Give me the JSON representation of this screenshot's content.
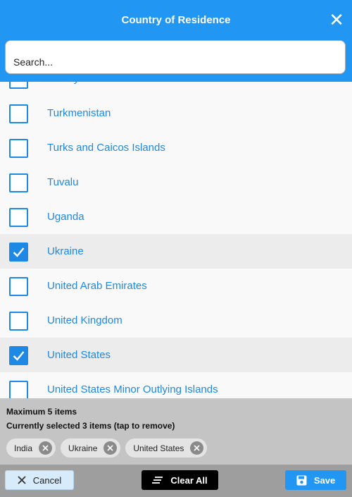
{
  "header": {
    "title": "Country of Residence",
    "close_glyph": "✕"
  },
  "search": {
    "placeholder": "Search..."
  },
  "list": {
    "items": [
      {
        "label": "Turkey",
        "checked": false
      },
      {
        "label": "Turkmenistan",
        "checked": false
      },
      {
        "label": "Turks and Caicos Islands",
        "checked": false
      },
      {
        "label": "Tuvalu",
        "checked": false
      },
      {
        "label": "Uganda",
        "checked": false
      },
      {
        "label": "Ukraine",
        "checked": true
      },
      {
        "label": "United Arab Emirates",
        "checked": false
      },
      {
        "label": "United Kingdom",
        "checked": false
      },
      {
        "label": "United States",
        "checked": true
      },
      {
        "label": "United States Minor Outlying Islands",
        "checked": false
      }
    ]
  },
  "selection": {
    "max_text": "Maximum 5 items",
    "count_text": "Currently selected 3 items (tap to remove)",
    "chips": [
      "India",
      "Ukraine",
      "United States"
    ]
  },
  "actions": {
    "cancel_label": "Cancel",
    "clear_label": "Clear All",
    "save_label": "Save"
  },
  "colors": {
    "accent": "#2196f3",
    "checkbox": "#1e88e5",
    "footer": "#c4c4c4",
    "action_bar": "#9e9e9e"
  }
}
